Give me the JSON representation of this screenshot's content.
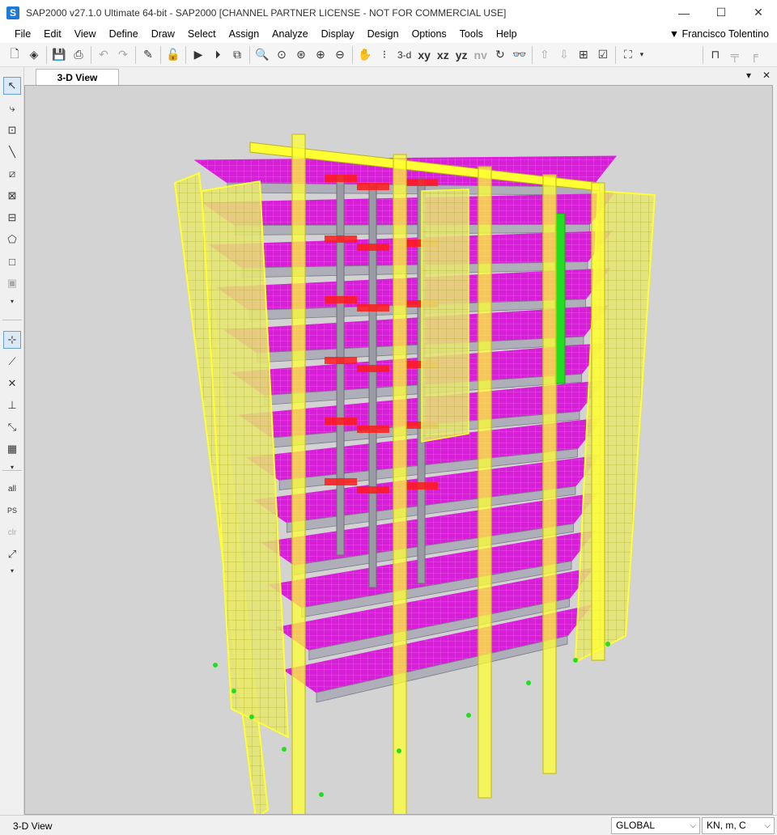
{
  "window": {
    "app_icon": "S",
    "title": "SAP2000 v27.1.0 Ultimate 64-bit - SAP2000  [CHANNEL PARTNER LICENSE - NOT FOR COMMERCIAL USE]",
    "minimize": "—",
    "maximize": "☐",
    "close": "✕"
  },
  "menu": [
    "File",
    "Edit",
    "View",
    "Define",
    "Draw",
    "Select",
    "Assign",
    "Analyze",
    "Display",
    "Design",
    "Options",
    "Tools",
    "Help"
  ],
  "user": "▼ Francisco Tolentino",
  "toolbar": {
    "view_3d": "3-d",
    "view_xy": "xy",
    "view_xz": "xz",
    "view_yz": "yz",
    "view_nv": "nv"
  },
  "left_tools": {
    "select_all": "all",
    "select_previous": "PS",
    "clear_selection": "clr"
  },
  "tab": {
    "label": "3-D View",
    "dropdown": "▾",
    "close": "✕"
  },
  "status": {
    "view_name": "3-D View",
    "coord_system": "GLOBAL",
    "units": "KN, m, C"
  },
  "colors": {
    "slab": "#e020e0",
    "wall": "#ffff33",
    "column_highlight": "#ff1a1a",
    "green_column": "#22dd22",
    "background": "#d3d3d3"
  }
}
